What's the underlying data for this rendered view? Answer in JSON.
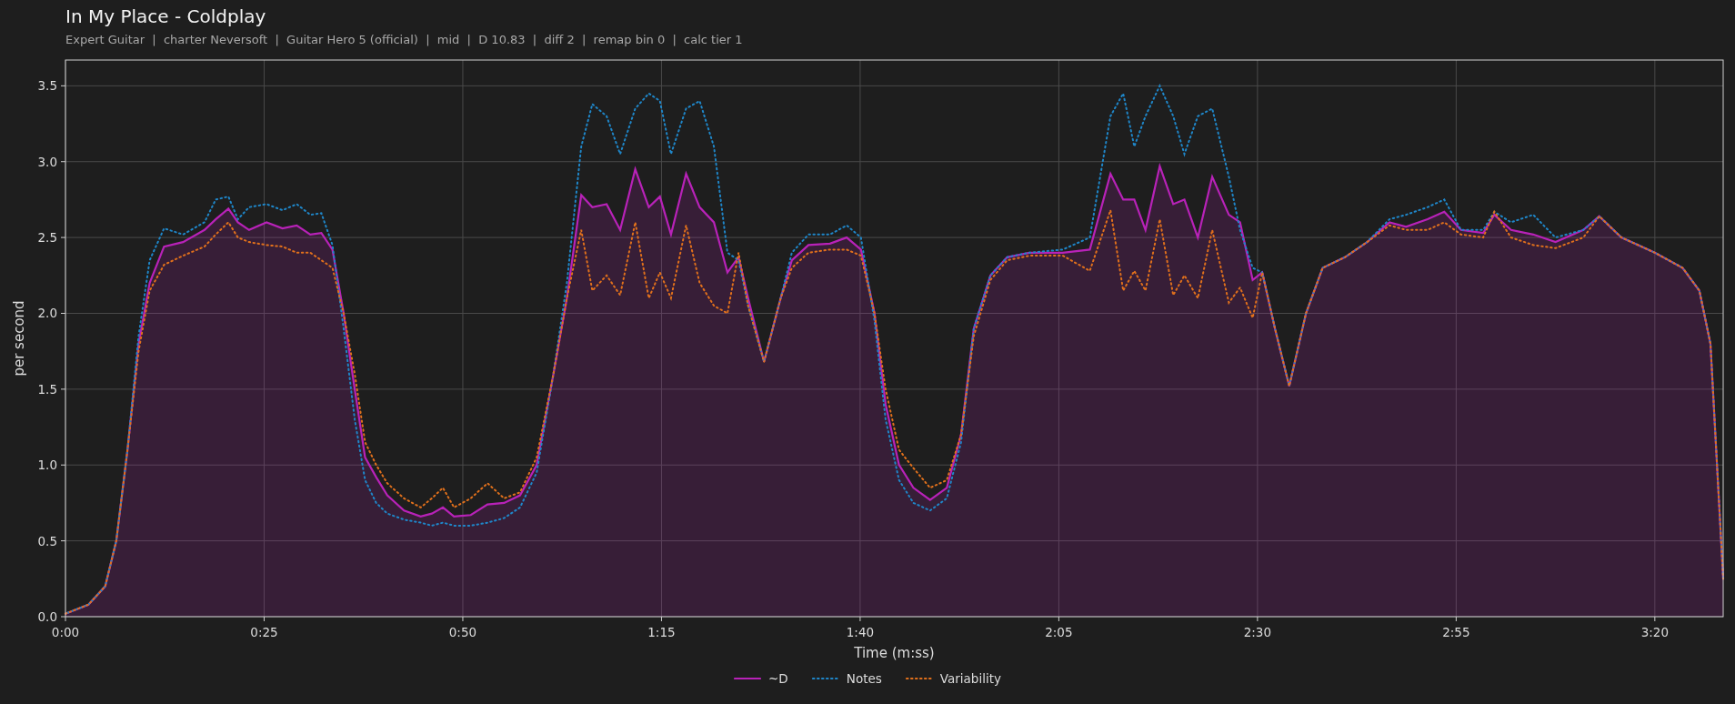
{
  "header": {
    "title": "In My Place - Coldplay",
    "subtitle": "Expert Guitar  |  charter Neversoft  |  Guitar Hero 5 (official)  |  mid  |  D 10.83  |  diff 2  |  remap bin 0  |  calc tier 1"
  },
  "chart": {
    "chart_data": {
      "type": "line",
      "grid": true,
      "xlabel": "Time (m:ss)",
      "ylabel": "per second",
      "xlim": [
        0,
        208.6
      ],
      "ylim": [
        0,
        3.67
      ],
      "xticks": [
        {
          "value": 0,
          "label": "0:00"
        },
        {
          "value": 25,
          "label": "0:25"
        },
        {
          "value": 50,
          "label": "0:50"
        },
        {
          "value": 75,
          "label": "1:15"
        },
        {
          "value": 100,
          "label": "1:40"
        },
        {
          "value": 125,
          "label": "2:05"
        },
        {
          "value": 150,
          "label": "2:30"
        },
        {
          "value": 175,
          "label": "2:55"
        },
        {
          "value": 200,
          "label": "3:20"
        }
      ],
      "yticks": [
        {
          "value": 0,
          "label": "0.0"
        },
        {
          "value": 0.5,
          "label": "0.5"
        },
        {
          "value": 1,
          "label": "1.0"
        },
        {
          "value": 1.5,
          "label": "1.5"
        },
        {
          "value": 2,
          "label": "2.0"
        },
        {
          "value": 2.5,
          "label": "2.5"
        },
        {
          "value": 3,
          "label": "3.0"
        },
        {
          "value": 3.5,
          "label": "3.5"
        }
      ],
      "x": [
        0,
        2.9,
        5,
        6.4,
        7.8,
        9.2,
        10.6,
        12.4,
        14.8,
        17.5,
        18.9,
        20.5,
        21.7,
        23.1,
        25.3,
        27.3,
        29.1,
        30.8,
        32.2,
        33.6,
        35,
        36.4,
        37.7,
        39.1,
        40.5,
        42.6,
        44.7,
        46.1,
        47.5,
        48.9,
        51,
        53.1,
        55.2,
        57.2,
        59.3,
        61.4,
        63.1,
        64.9,
        66.3,
        68.1,
        69.8,
        71.7,
        73.4,
        74.8,
        76.2,
        78.1,
        79.8,
        81.6,
        83.3,
        84.7,
        85.9,
        87.9,
        90,
        91.4,
        93.5,
        96.2,
        98.3,
        100.1,
        101.8,
        103.2,
        104.9,
        106.7,
        108.8,
        110.9,
        112.7,
        114.3,
        116.4,
        118.5,
        121.3,
        125.5,
        128.9,
        131.5,
        133.1,
        134.5,
        135.9,
        137.7,
        139.4,
        140.8,
        142.5,
        144.3,
        146.4,
        147.8,
        149.4,
        150.6,
        152.2,
        154,
        156.1,
        158.2,
        161,
        163.8,
        166.6,
        168.7,
        171.4,
        173.5,
        175.6,
        178.4,
        179.8,
        181.9,
        184.7,
        187.5,
        191,
        193,
        195.8,
        200,
        203.5,
        205.6,
        207,
        208.6
      ],
      "series": [
        {
          "name": "~D",
          "color": "#b822b8",
          "line_style": "solid",
          "type": "area",
          "values": [
            0.02,
            0.08,
            0.2,
            0.5,
            1.1,
            1.8,
            2.2,
            2.44,
            2.47,
            2.55,
            2.62,
            2.69,
            2.6,
            2.55,
            2.6,
            2.56,
            2.58,
            2.52,
            2.53,
            2.42,
            2.0,
            1.5,
            1.05,
            0.92,
            0.8,
            0.7,
            0.66,
            0.68,
            0.72,
            0.66,
            0.67,
            0.74,
            0.75,
            0.8,
            1.0,
            1.6,
            2.1,
            2.78,
            2.7,
            2.72,
            2.55,
            2.95,
            2.7,
            2.77,
            2.52,
            2.92,
            2.7,
            2.6,
            2.27,
            2.37,
            2.1,
            1.68,
            2.1,
            2.35,
            2.45,
            2.46,
            2.5,
            2.42,
            2.0,
            1.4,
            1.0,
            0.85,
            0.77,
            0.85,
            1.2,
            1.9,
            2.25,
            2.37,
            2.4,
            2.4,
            2.42,
            2.92,
            2.75,
            2.75,
            2.55,
            2.97,
            2.72,
            2.75,
            2.5,
            2.9,
            2.65,
            2.6,
            2.22,
            2.27,
            1.9,
            1.52,
            2.0,
            2.3,
            2.37,
            2.47,
            2.6,
            2.57,
            2.62,
            2.67,
            2.55,
            2.53,
            2.65,
            2.55,
            2.52,
            2.47,
            2.55,
            2.64,
            2.5,
            2.4,
            2.3,
            2.15,
            1.8,
            0.25
          ]
        },
        {
          "name": "Notes",
          "color": "#1f86c8",
          "line_style": "dotted",
          "values": [
            0.02,
            0.08,
            0.2,
            0.5,
            1.1,
            1.85,
            2.35,
            2.56,
            2.52,
            2.6,
            2.75,
            2.77,
            2.62,
            2.7,
            2.72,
            2.68,
            2.72,
            2.65,
            2.66,
            2.45,
            1.9,
            1.3,
            0.9,
            0.75,
            0.68,
            0.64,
            0.62,
            0.6,
            0.62,
            0.6,
            0.6,
            0.62,
            0.65,
            0.72,
            0.95,
            1.6,
            2.2,
            3.1,
            3.38,
            3.3,
            3.05,
            3.35,
            3.45,
            3.4,
            3.05,
            3.35,
            3.4,
            3.1,
            2.4,
            2.35,
            2.05,
            1.68,
            2.1,
            2.4,
            2.52,
            2.52,
            2.58,
            2.5,
            1.95,
            1.3,
            0.9,
            0.75,
            0.7,
            0.78,
            1.15,
            1.9,
            2.25,
            2.37,
            2.4,
            2.42,
            2.5,
            3.3,
            3.45,
            3.1,
            3.3,
            3.5,
            3.3,
            3.05,
            3.3,
            3.35,
            2.9,
            2.55,
            2.3,
            2.27,
            1.9,
            1.52,
            2.0,
            2.3,
            2.37,
            2.47,
            2.62,
            2.65,
            2.7,
            2.75,
            2.55,
            2.55,
            2.67,
            2.6,
            2.65,
            2.5,
            2.55,
            2.64,
            2.5,
            2.4,
            2.3,
            2.15,
            1.8,
            0.25
          ]
        },
        {
          "name": "Variability",
          "color": "#e0701c",
          "line_style": "dotted",
          "values": [
            0.02,
            0.08,
            0.2,
            0.5,
            1.1,
            1.75,
            2.15,
            2.32,
            2.38,
            2.44,
            2.52,
            2.6,
            2.5,
            2.47,
            2.45,
            2.44,
            2.4,
            2.4,
            2.35,
            2.3,
            2.0,
            1.6,
            1.15,
            1.0,
            0.88,
            0.78,
            0.72,
            0.78,
            0.85,
            0.72,
            0.78,
            0.88,
            0.78,
            0.82,
            1.05,
            1.6,
            2.1,
            2.55,
            2.15,
            2.25,
            2.12,
            2.6,
            2.1,
            2.27,
            2.1,
            2.58,
            2.2,
            2.05,
            2.0,
            2.4,
            2.05,
            1.68,
            2.1,
            2.3,
            2.4,
            2.42,
            2.42,
            2.38,
            2.0,
            1.5,
            1.1,
            0.98,
            0.85,
            0.9,
            1.2,
            1.85,
            2.22,
            2.35,
            2.38,
            2.38,
            2.28,
            2.68,
            2.15,
            2.28,
            2.15,
            2.62,
            2.12,
            2.25,
            2.1,
            2.55,
            2.07,
            2.17,
            1.97,
            2.27,
            1.9,
            1.52,
            2.0,
            2.3,
            2.37,
            2.47,
            2.58,
            2.55,
            2.55,
            2.6,
            2.52,
            2.5,
            2.67,
            2.5,
            2.45,
            2.43,
            2.5,
            2.64,
            2.5,
            2.4,
            2.3,
            2.15,
            1.8,
            0.25
          ]
        }
      ]
    }
  }
}
